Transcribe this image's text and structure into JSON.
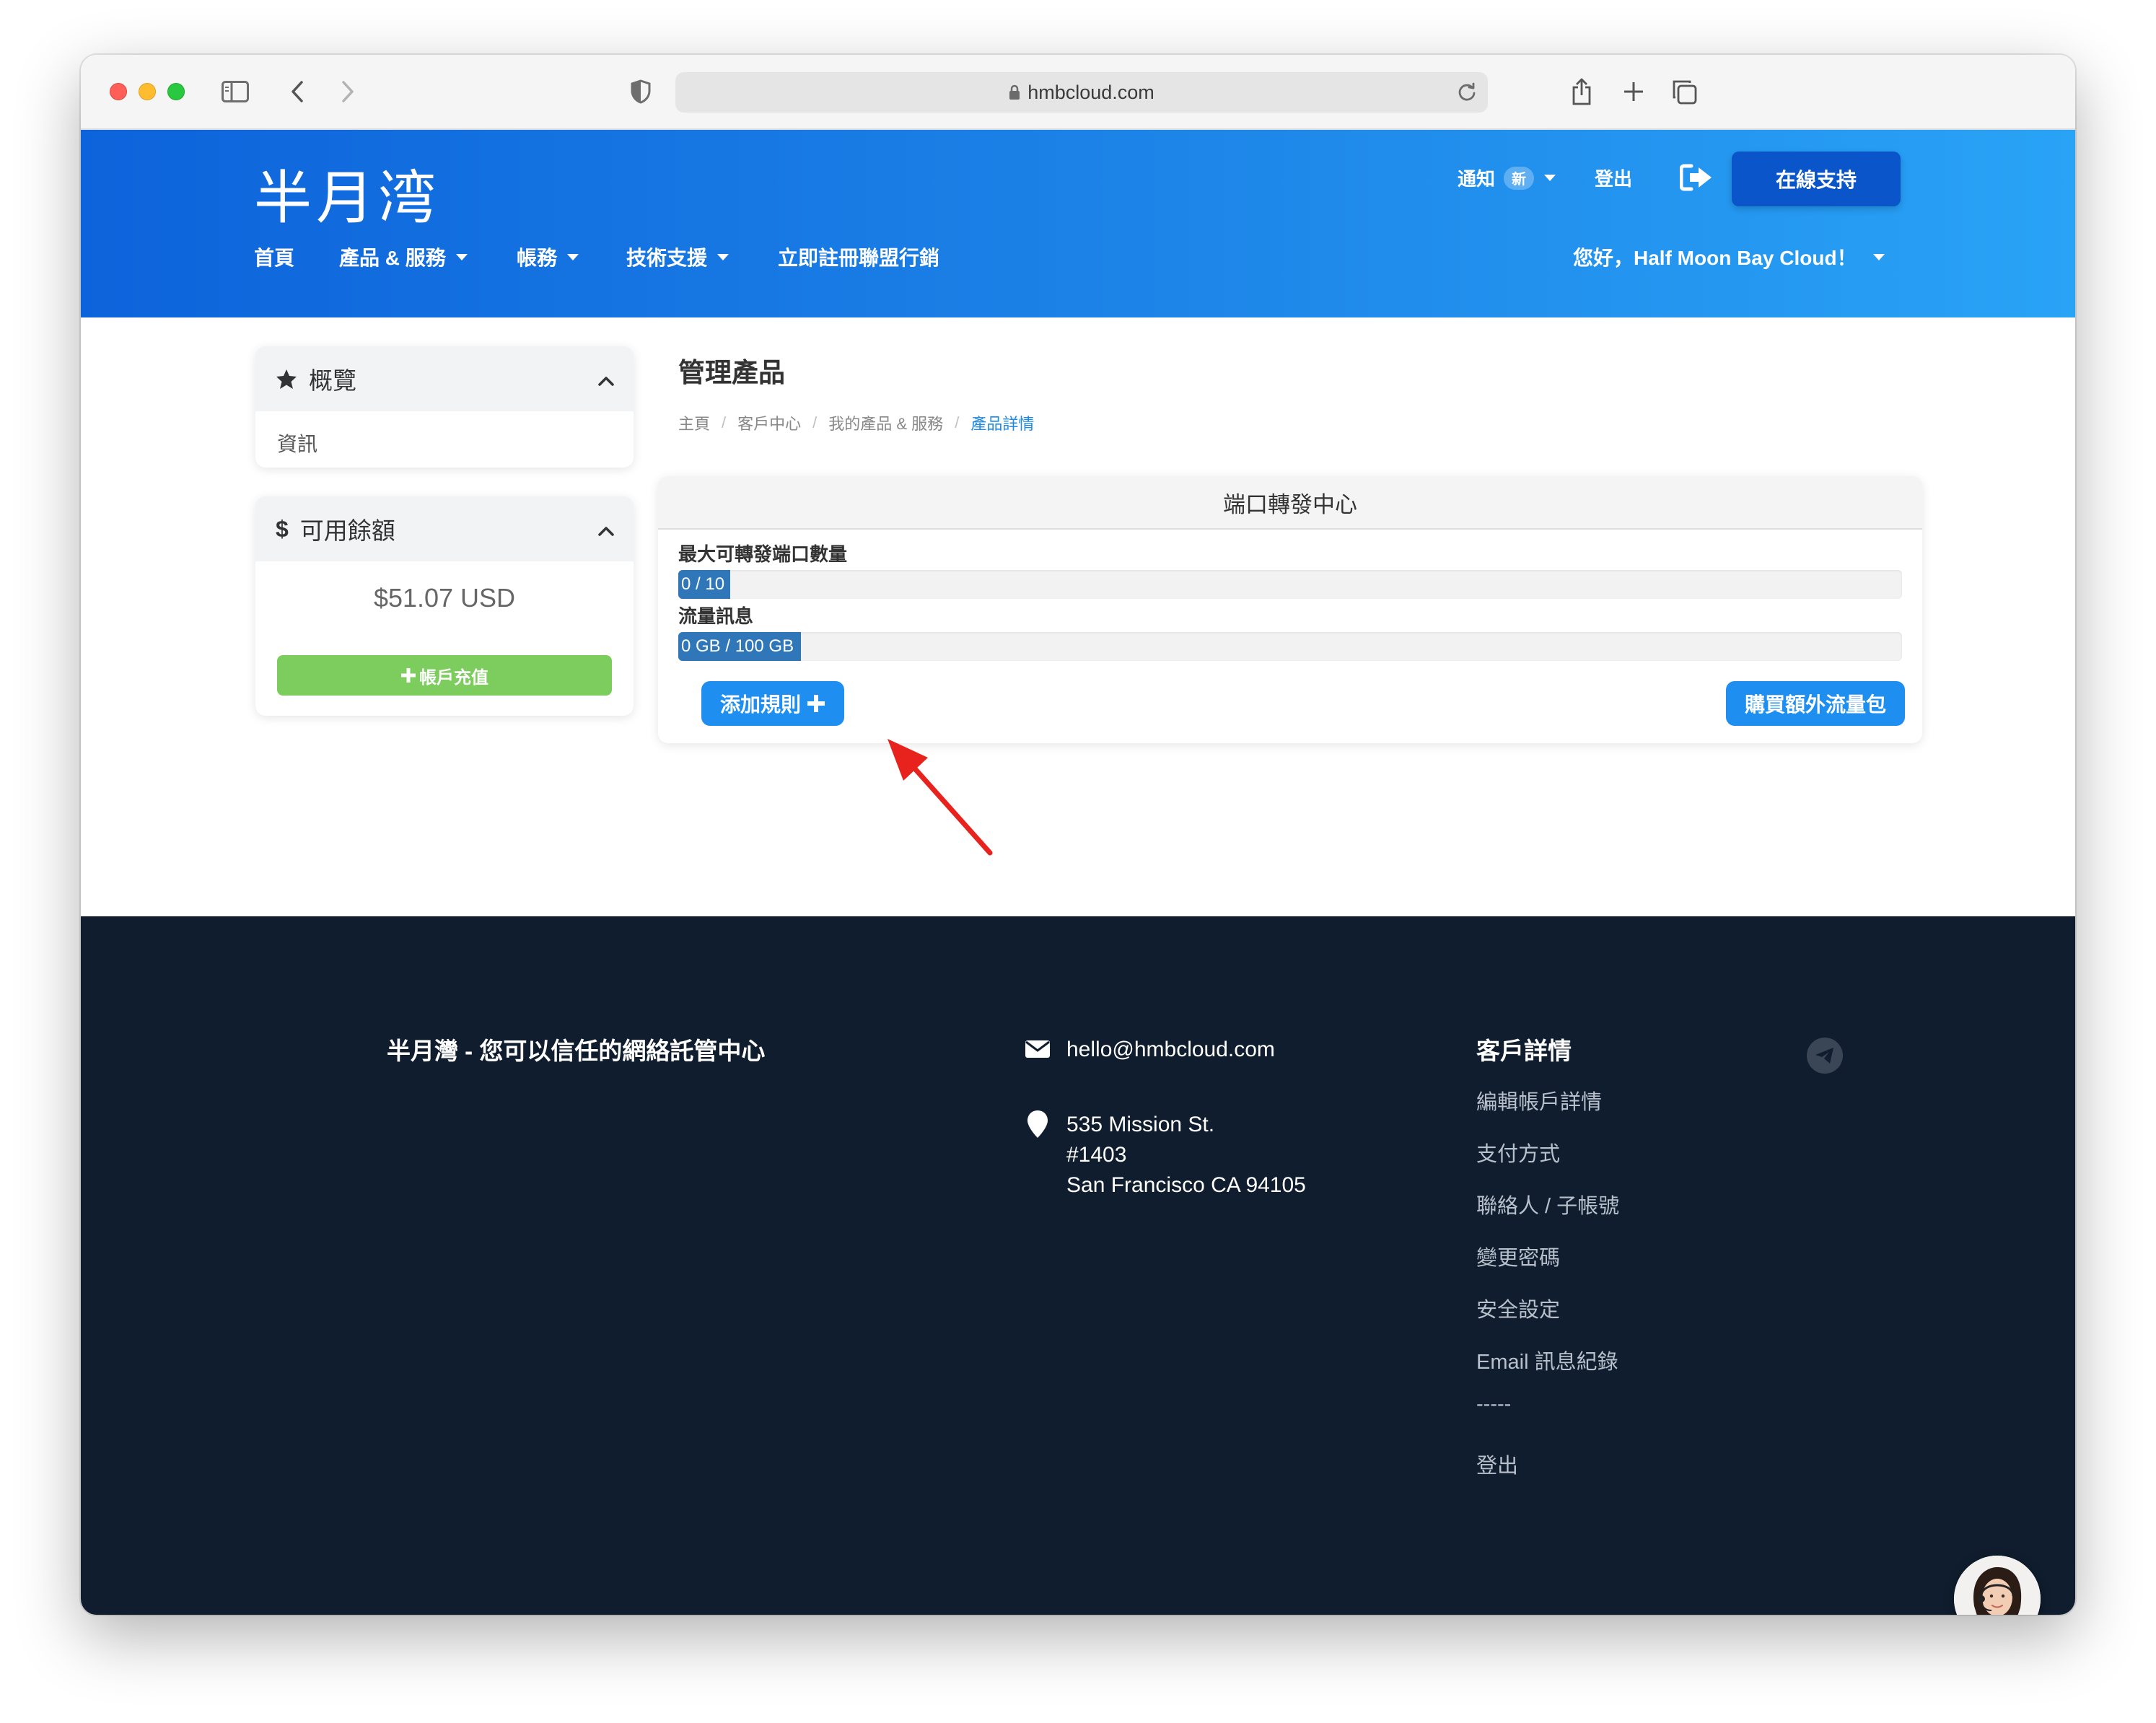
{
  "browser": {
    "url": "hmbcloud.com"
  },
  "header": {
    "logo": "半月湾",
    "notify_label": "通知",
    "notify_badge": "新",
    "logout_label": "登出",
    "support_button": "在線支持",
    "nav": {
      "home": "首頁",
      "products": "產品 & 服務",
      "billing": "帳務",
      "support": "技術支援",
      "affiliate": "立即註冊聯盟行銷"
    },
    "greeting": "您好，Half Moon Bay Cloud！"
  },
  "sidebar": {
    "overview_title": "概覽",
    "overview_item": "資訊",
    "balance_title": "可用餘額",
    "balance_amount": "$51.07 USD",
    "topup_button": "帳戶充值"
  },
  "main": {
    "page_title": "管理產品",
    "breadcrumb": [
      "主頁",
      "客戶中心",
      "我的產品 & 服務",
      "產品詳情"
    ],
    "panel_title": "端口轉發中心",
    "ports_label": "最大可轉發端口數量",
    "ports_value": "0 / 10",
    "ports_fraction": 0,
    "traffic_label": "流量訊息",
    "traffic_value": "0 GB / 100 GB",
    "traffic_fraction": 0,
    "add_rule_button": "添加規則",
    "buy_traffic_button": "購買額外流量包"
  },
  "footer": {
    "tagline": "半月灣 - 您可以信任的網絡託管中心",
    "email": "hello@hmbcloud.com",
    "address_line1": "535 Mission St.",
    "address_line2": "#1403",
    "address_line3": "San Francisco CA 94105",
    "client_heading": "客戶詳情",
    "links": [
      "編輯帳戶詳情",
      "支付方式",
      "聯絡人 / 子帳號",
      "變更密碼",
      "安全設定",
      "Email 訊息紀錄",
      "-----",
      "登出"
    ]
  },
  "colors": {
    "header_start": "#0d63db",
    "header_end": "#29a3f6",
    "accent_blue": "#1e8ef0",
    "topup_green": "#7ccd5e",
    "footer_bg": "#0f1d2e",
    "annotation_red": "#e8221c"
  }
}
